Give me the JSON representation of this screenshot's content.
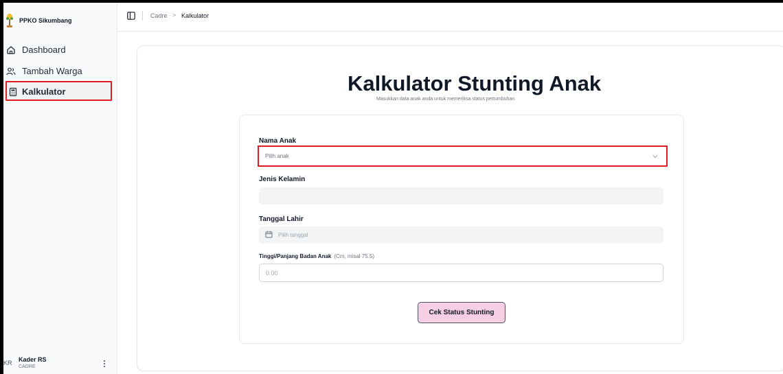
{
  "app": {
    "brand_name": "PPKO Sikumbang"
  },
  "sidebar": {
    "items": [
      {
        "label": "Dashboard",
        "icon": "home-icon"
      },
      {
        "label": "Tambah Warga",
        "icon": "users-icon"
      },
      {
        "label": "Kalkulator",
        "icon": "calculator-icon",
        "active": true
      }
    ],
    "user": {
      "initials": "KR",
      "name": "Kader RS",
      "role": "CADRE"
    }
  },
  "header": {
    "breadcrumb": [
      "Cadre",
      "Kalkulator"
    ],
    "breadcrumb_separator": ">"
  },
  "main": {
    "title": "Kalkulator Stunting Anak",
    "subtitle": "Masukkan data anak anda untuk memeriksa status pertumbuhan",
    "form": {
      "child_name_label": "Nama Anak",
      "child_name_placeholder": "Pilih anak",
      "gender_label": "Jenis Kelamin",
      "gender_value": "",
      "birthdate_label": "Tanggal Lahir",
      "birthdate_placeholder": "Pilih tanggal",
      "height_label": "Tinggi/Panjang Badan Anak",
      "height_hint": "(Cm, misal 75.5)",
      "height_placeholder": "0.00",
      "submit_label": "Cek Status Stunting"
    }
  },
  "colors": {
    "highlight": "#e31b23",
    "button_bg": "#f7cfe4",
    "readonly_bg": "#f3f4f6"
  }
}
